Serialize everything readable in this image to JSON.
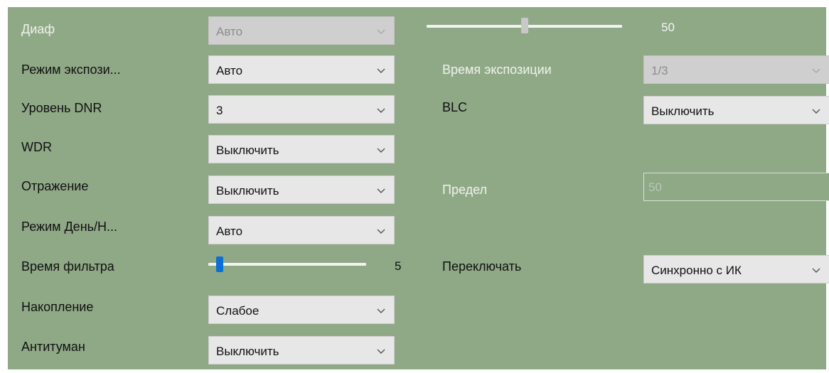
{
  "left": {
    "diaf": {
      "label": "Диаф",
      "value": "Авто"
    },
    "exposure_mode": {
      "label": "Режим экспози...",
      "value": "Авто"
    },
    "dnr_level": {
      "label": "Уровень DNR",
      "value": "3"
    },
    "wdr": {
      "label": "WDR",
      "value": "Выключить"
    },
    "mirror": {
      "label": "Отражение",
      "value": "Выключить"
    },
    "day_night": {
      "label": "Режим День/Н...",
      "value": "Авто"
    },
    "filter_time": {
      "label": "Время фильтра",
      "value": "5",
      "level": 5,
      "range": [
        0,
        100
      ]
    },
    "accumulation": {
      "label": "Накопление",
      "value": "Слабое"
    },
    "antifog": {
      "label": "Антитуман",
      "value": "Выключить"
    }
  },
  "right": {
    "diaf_slider": {
      "value": "50",
      "level": 50,
      "range": [
        0,
        100
      ]
    },
    "exposure_time": {
      "label": "Время экспозиции",
      "value": "1/3"
    },
    "blc": {
      "label": "BLC",
      "value": "Выключить"
    },
    "limit": {
      "label": "Предел",
      "value": "50"
    },
    "switch": {
      "label": "Переключать",
      "value": "Синхронно с ИК"
    }
  },
  "colors": {
    "panel_bg": "#8fa886",
    "select_bg": "#e7e7e7",
    "slider_thumb": "#0a6fd6",
    "disabled_thumb": "#c8c8c8"
  },
  "icons": {
    "dropdown": "chevron-down-icon"
  }
}
